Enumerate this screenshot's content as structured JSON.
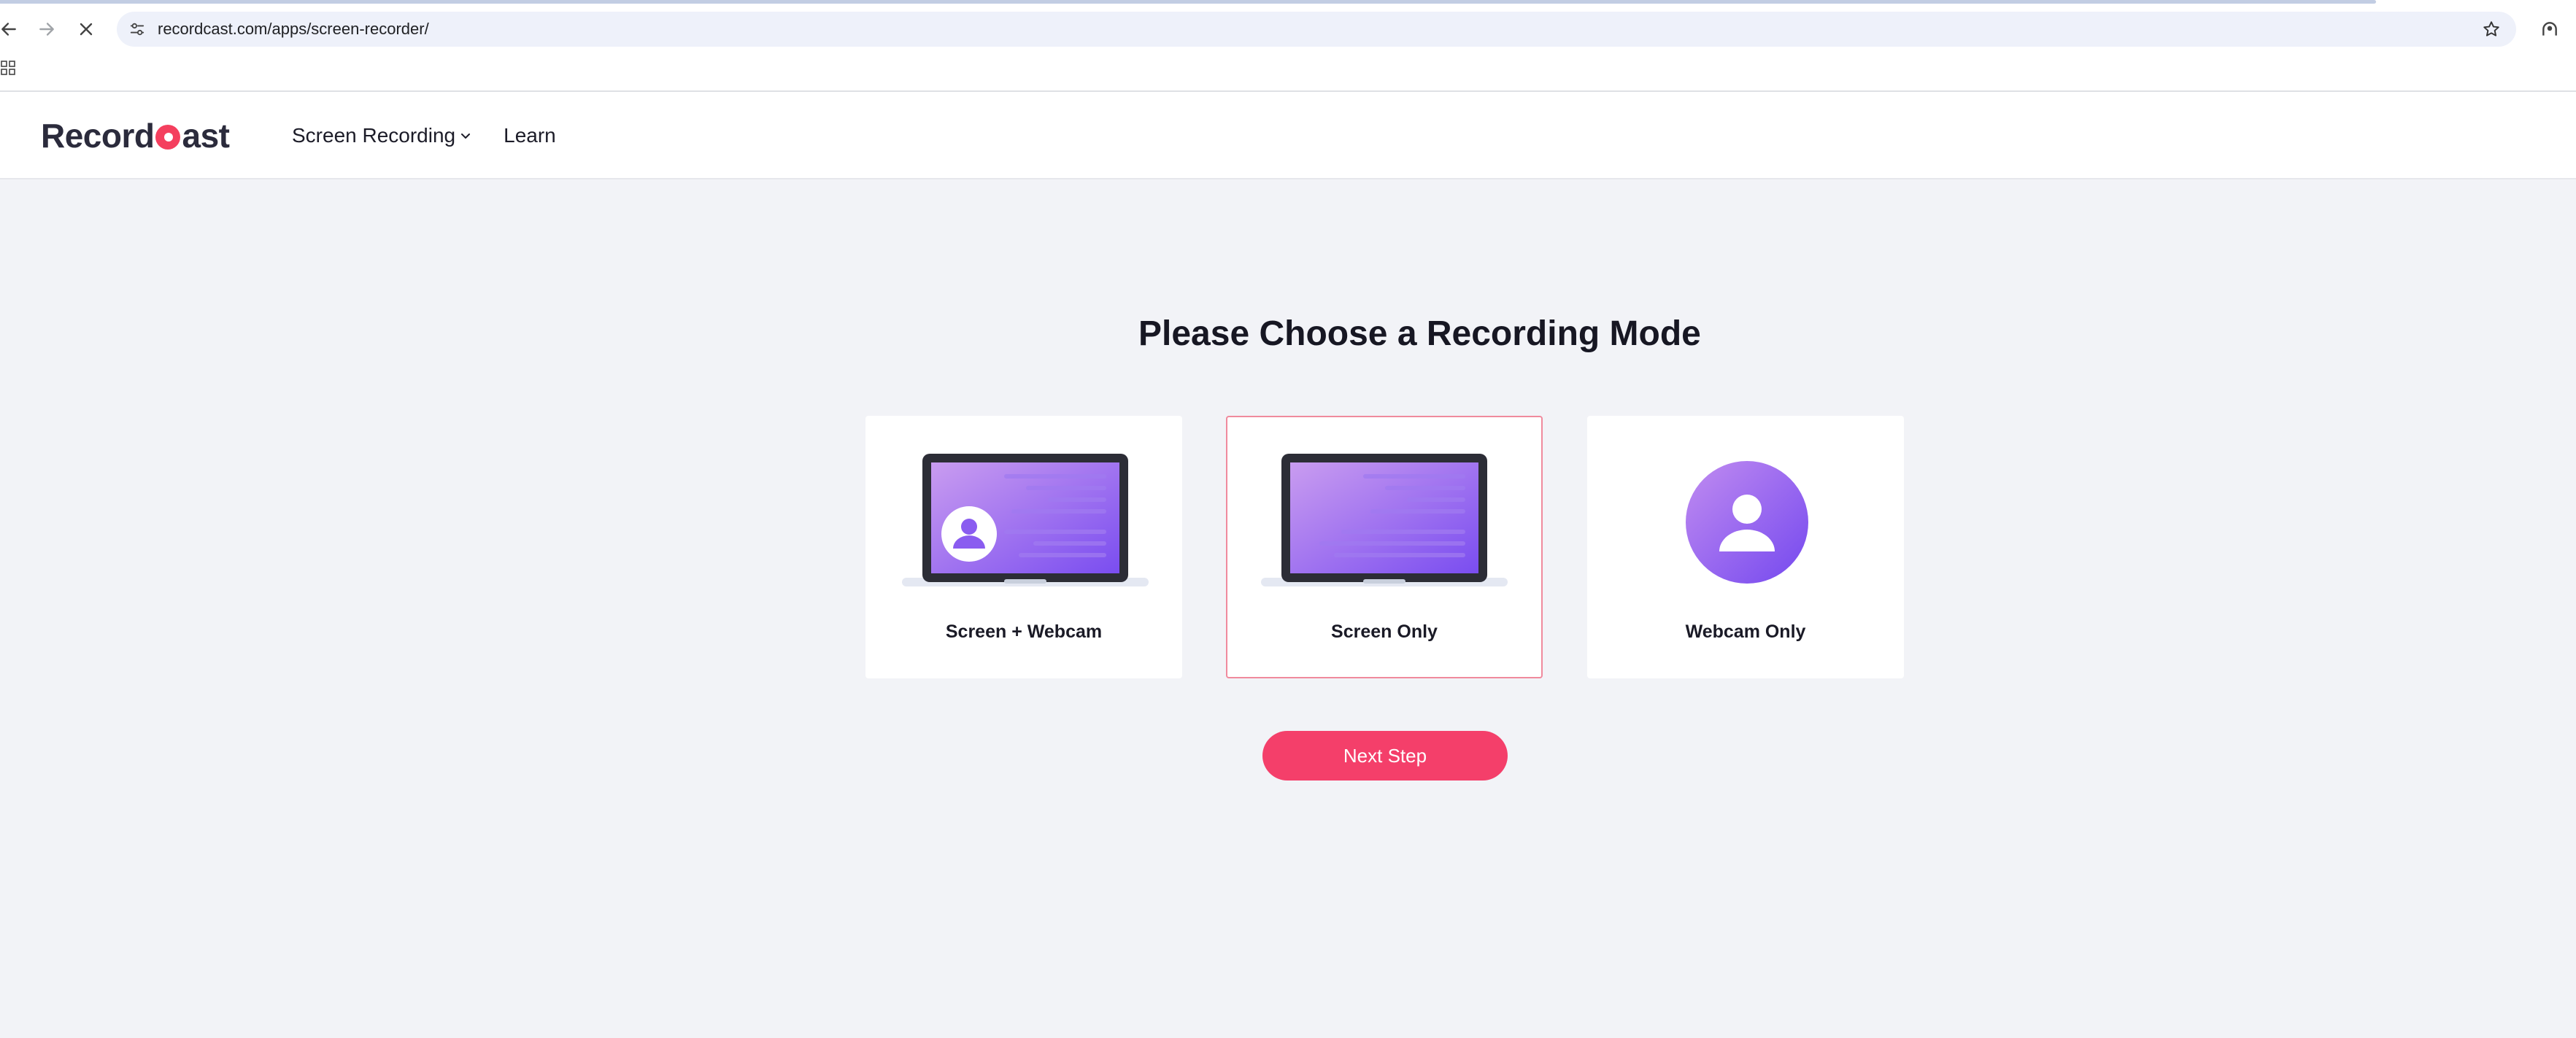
{
  "browser": {
    "url": "recordcast.com/apps/screen-recorder/",
    "back_icon": "arrow-left-icon",
    "forward_icon": "arrow-right-icon",
    "stop_icon": "close-icon",
    "bookmark_icon": "star-icon",
    "apps_icon": "grid-icon",
    "profile_icon": "profile-icon"
  },
  "header": {
    "logo_prefix": "Record",
    "logo_suffix": "ast",
    "nav": [
      {
        "label": "Screen Recording",
        "has_dropdown": true
      },
      {
        "label": "Learn",
        "has_dropdown": false
      }
    ]
  },
  "main": {
    "title": "Please Choose a Recording Mode",
    "modes": [
      {
        "label": "Screen + Webcam",
        "icon": "laptop-with-webcam-icon",
        "selected": false
      },
      {
        "label": "Screen Only",
        "icon": "laptop-icon",
        "selected": true
      },
      {
        "label": "Webcam Only",
        "icon": "webcam-person-icon",
        "selected": false
      }
    ],
    "next_button": "Next Step"
  },
  "colors": {
    "accent": "#f43f6a",
    "selected_border": "#f08a9d",
    "background": "#f2f3f7",
    "illustration_purple": "#8b5cf6"
  }
}
